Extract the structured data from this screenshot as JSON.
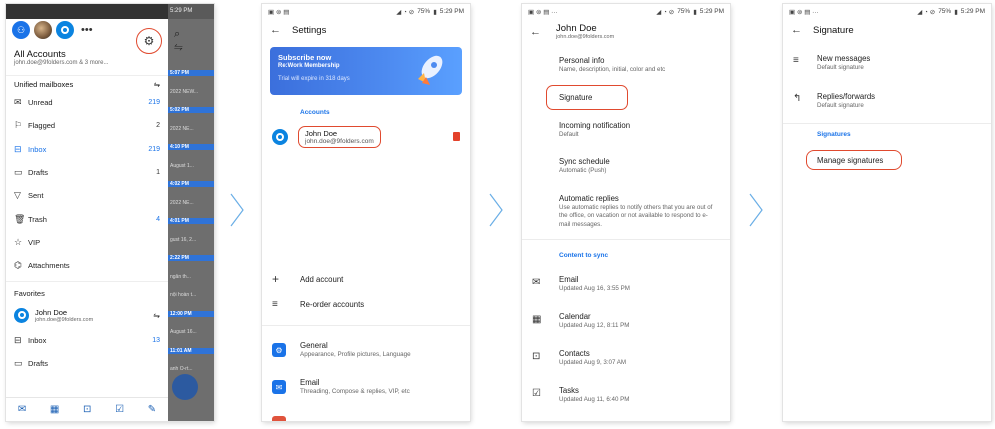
{
  "status_bar": {
    "time": "5:29 PM",
    "battery": "75%"
  },
  "phone1": {
    "account_title": "All Accounts",
    "account_sub": "john.doe@9folders.com & 3 more...",
    "unified_header": "Unified mailboxes",
    "folders": [
      {
        "label": "Unread",
        "count": "219",
        "icon": "envelope-icon",
        "glyph": "✉",
        "blue": true
      },
      {
        "label": "Flagged",
        "count": "2",
        "icon": "flag-icon",
        "glyph": "⚐",
        "blue": false
      },
      {
        "label": "Inbox",
        "count": "219",
        "icon": "inbox-icon",
        "glyph": "⊟",
        "blue": true
      },
      {
        "label": "Drafts",
        "count": "1",
        "icon": "drafts-icon",
        "glyph": "▭",
        "blue": false
      },
      {
        "label": "Sent",
        "count": "",
        "icon": "send-icon",
        "glyph": "▽",
        "blue": false
      },
      {
        "label": "Trash",
        "count": "4",
        "icon": "trash-icon",
        "glyph": "🗑",
        "blue": true
      },
      {
        "label": "VIP",
        "count": "",
        "icon": "star-icon",
        "glyph": "☆",
        "blue": false
      },
      {
        "label": "Attachments",
        "count": "",
        "icon": "attachment-icon",
        "glyph": "⌬",
        "blue": false
      }
    ],
    "favorites_header": "Favorites",
    "fav_account_name": "John Doe",
    "fav_account_email": "john.doe@9folders.com",
    "fav_inbox": "Inbox",
    "fav_inbox_count": "13",
    "fav_drafts": "Drafts",
    "bg_items": [
      "5:07 PM",
      "2022 NEW...",
      "5:02 PM",
      "2022 NE...",
      "4:10 PM",
      "August 1...",
      "4:02 PM",
      "2022 NE...",
      "4:01 PM",
      "gust 16, 2...",
      "2:22 PM",
      "ngân th...",
      "nội hoàn t...",
      "12:00 PM",
      "August 16...",
      "11:01 AM",
      "anh Ô-rt..."
    ]
  },
  "phone2": {
    "title": "Settings",
    "banner_title": "Subscribe now",
    "banner_sub": "Re:Work Membership",
    "banner_trial": "Trial will expire in 318 days",
    "accounts_label": "Accounts",
    "account_name": "John Doe",
    "account_email": "john.doe@9folders.com",
    "add_account": "Add account",
    "reorder_accounts": "Re-order accounts",
    "general_title": "General",
    "general_sub": "Appearance, Profile pictures, Language",
    "email_title": "Email",
    "email_sub": "Threading, Compose & replies, VIP, etc"
  },
  "phone3": {
    "name": "John Doe",
    "email": "john.doe@9folders.com",
    "personal_title": "Personal info",
    "personal_sub": "Name, description, initial, color and etc",
    "signature": "Signature",
    "incoming_title": "Incoming notification",
    "incoming_sub": "Default",
    "sync_title": "Sync schedule",
    "sync_sub": "Automatic (Push)",
    "auto_title": "Automatic replies",
    "auto_sub": "Use automatic replies to notify others that you are out of the office, on vacation or not available to respond to e-mail messages.",
    "content_label": "Content to sync",
    "sync_items": [
      {
        "title": "Email",
        "sub": "Updated Aug 16, 3:55 PM",
        "icon": "mail-icon",
        "glyph": "✉"
      },
      {
        "title": "Calendar",
        "sub": "Updated Aug 12, 8:11 PM",
        "icon": "calendar-icon",
        "glyph": "▦"
      },
      {
        "title": "Contacts",
        "sub": "Updated Aug 9, 3:07 AM",
        "icon": "contacts-icon",
        "glyph": "⊡"
      },
      {
        "title": "Tasks",
        "sub": "Updated Aug 11, 6:40 PM",
        "icon": "tasks-icon",
        "glyph": "☑"
      }
    ]
  },
  "phone4": {
    "title": "Signature",
    "new_title": "New messages",
    "new_sub": "Default signature",
    "replies_title": "Replies/forwards",
    "replies_sub": "Default signature",
    "signatures_label": "Signatures",
    "manage": "Manage signatures"
  }
}
